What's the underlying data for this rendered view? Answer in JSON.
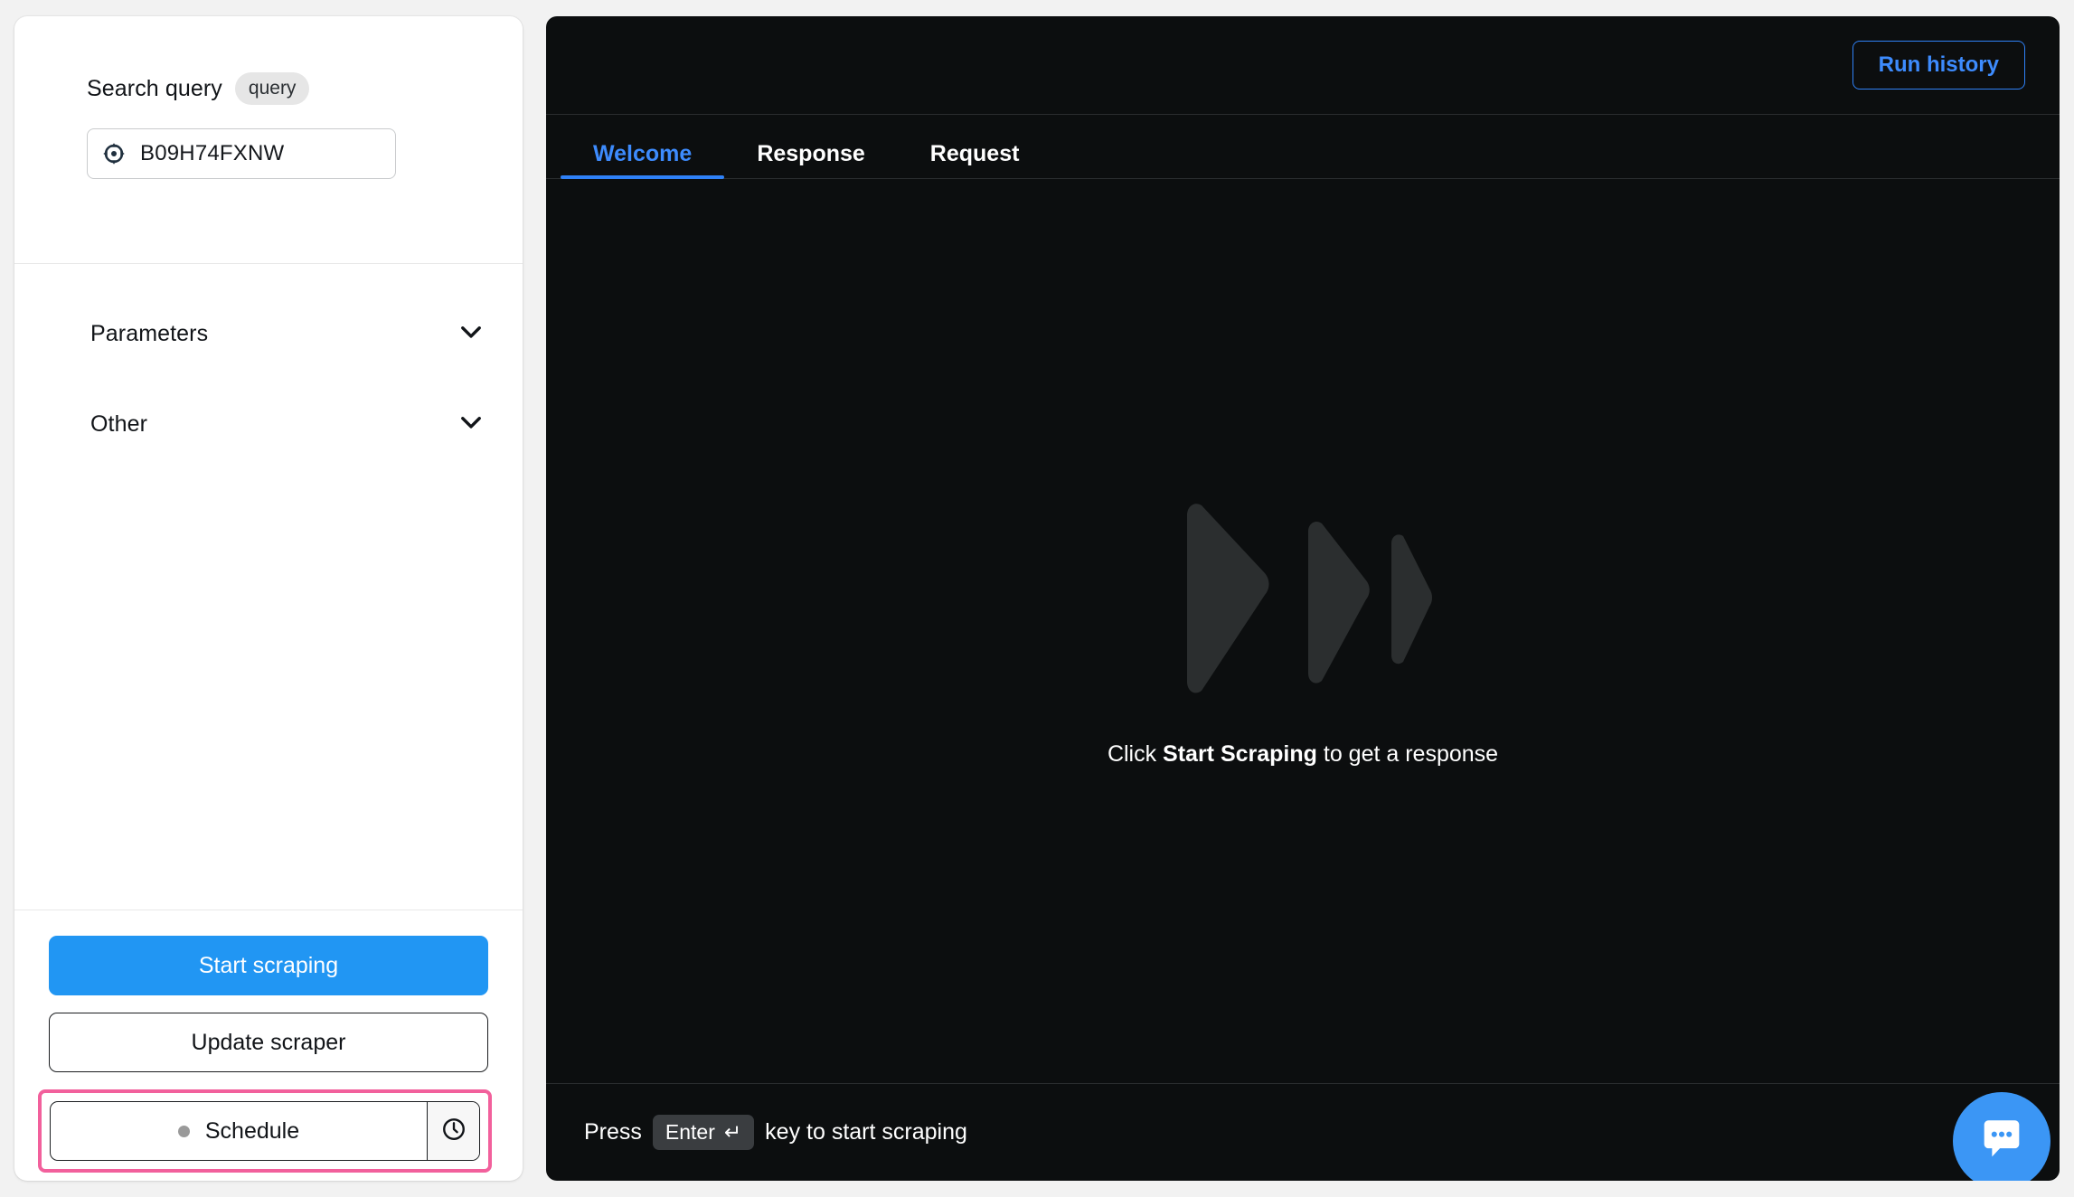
{
  "left_panel": {
    "query_section": {
      "label": "Search query",
      "chip": "query",
      "input": {
        "value": "B09H74FXNW",
        "placeholder": "B09H74FXNW",
        "icon": "crosshair-target-icon"
      }
    },
    "groups": [
      {
        "title": "Parameters",
        "icon": "chevron-down-icon"
      },
      {
        "title": "Other",
        "icon": "chevron-down-icon"
      }
    ],
    "actions": {
      "start_label": "Start scraping",
      "update_label": "Update scraper",
      "schedule_label": "Schedule",
      "schedule_icon": "clock-icon",
      "schedule_status_dot": "inactive"
    }
  },
  "right_panel": {
    "run_history_label": "Run history",
    "tabs": [
      {
        "label": "Welcome",
        "active": true
      },
      {
        "label": "Response",
        "active": false
      },
      {
        "label": "Request",
        "active": false
      }
    ],
    "empty_state": {
      "logo": "apify-chevrons-logo",
      "text_before": "Click ",
      "text_bold": "Start Scraping",
      "text_after": " to get a response"
    },
    "footer": {
      "press_label": "Press",
      "key_label": "Enter",
      "key_glyph": "↵",
      "tail_label": "key to start scraping"
    }
  },
  "chat_widget": {
    "icon": "chat-bubble-icon"
  },
  "colors": {
    "accent_blue": "#2196f3",
    "link_blue": "#3d8bfd",
    "highlight_pink": "#f2609c",
    "panel_dark": "#0c0e0f",
    "page_bg": "#f2f2f2"
  }
}
